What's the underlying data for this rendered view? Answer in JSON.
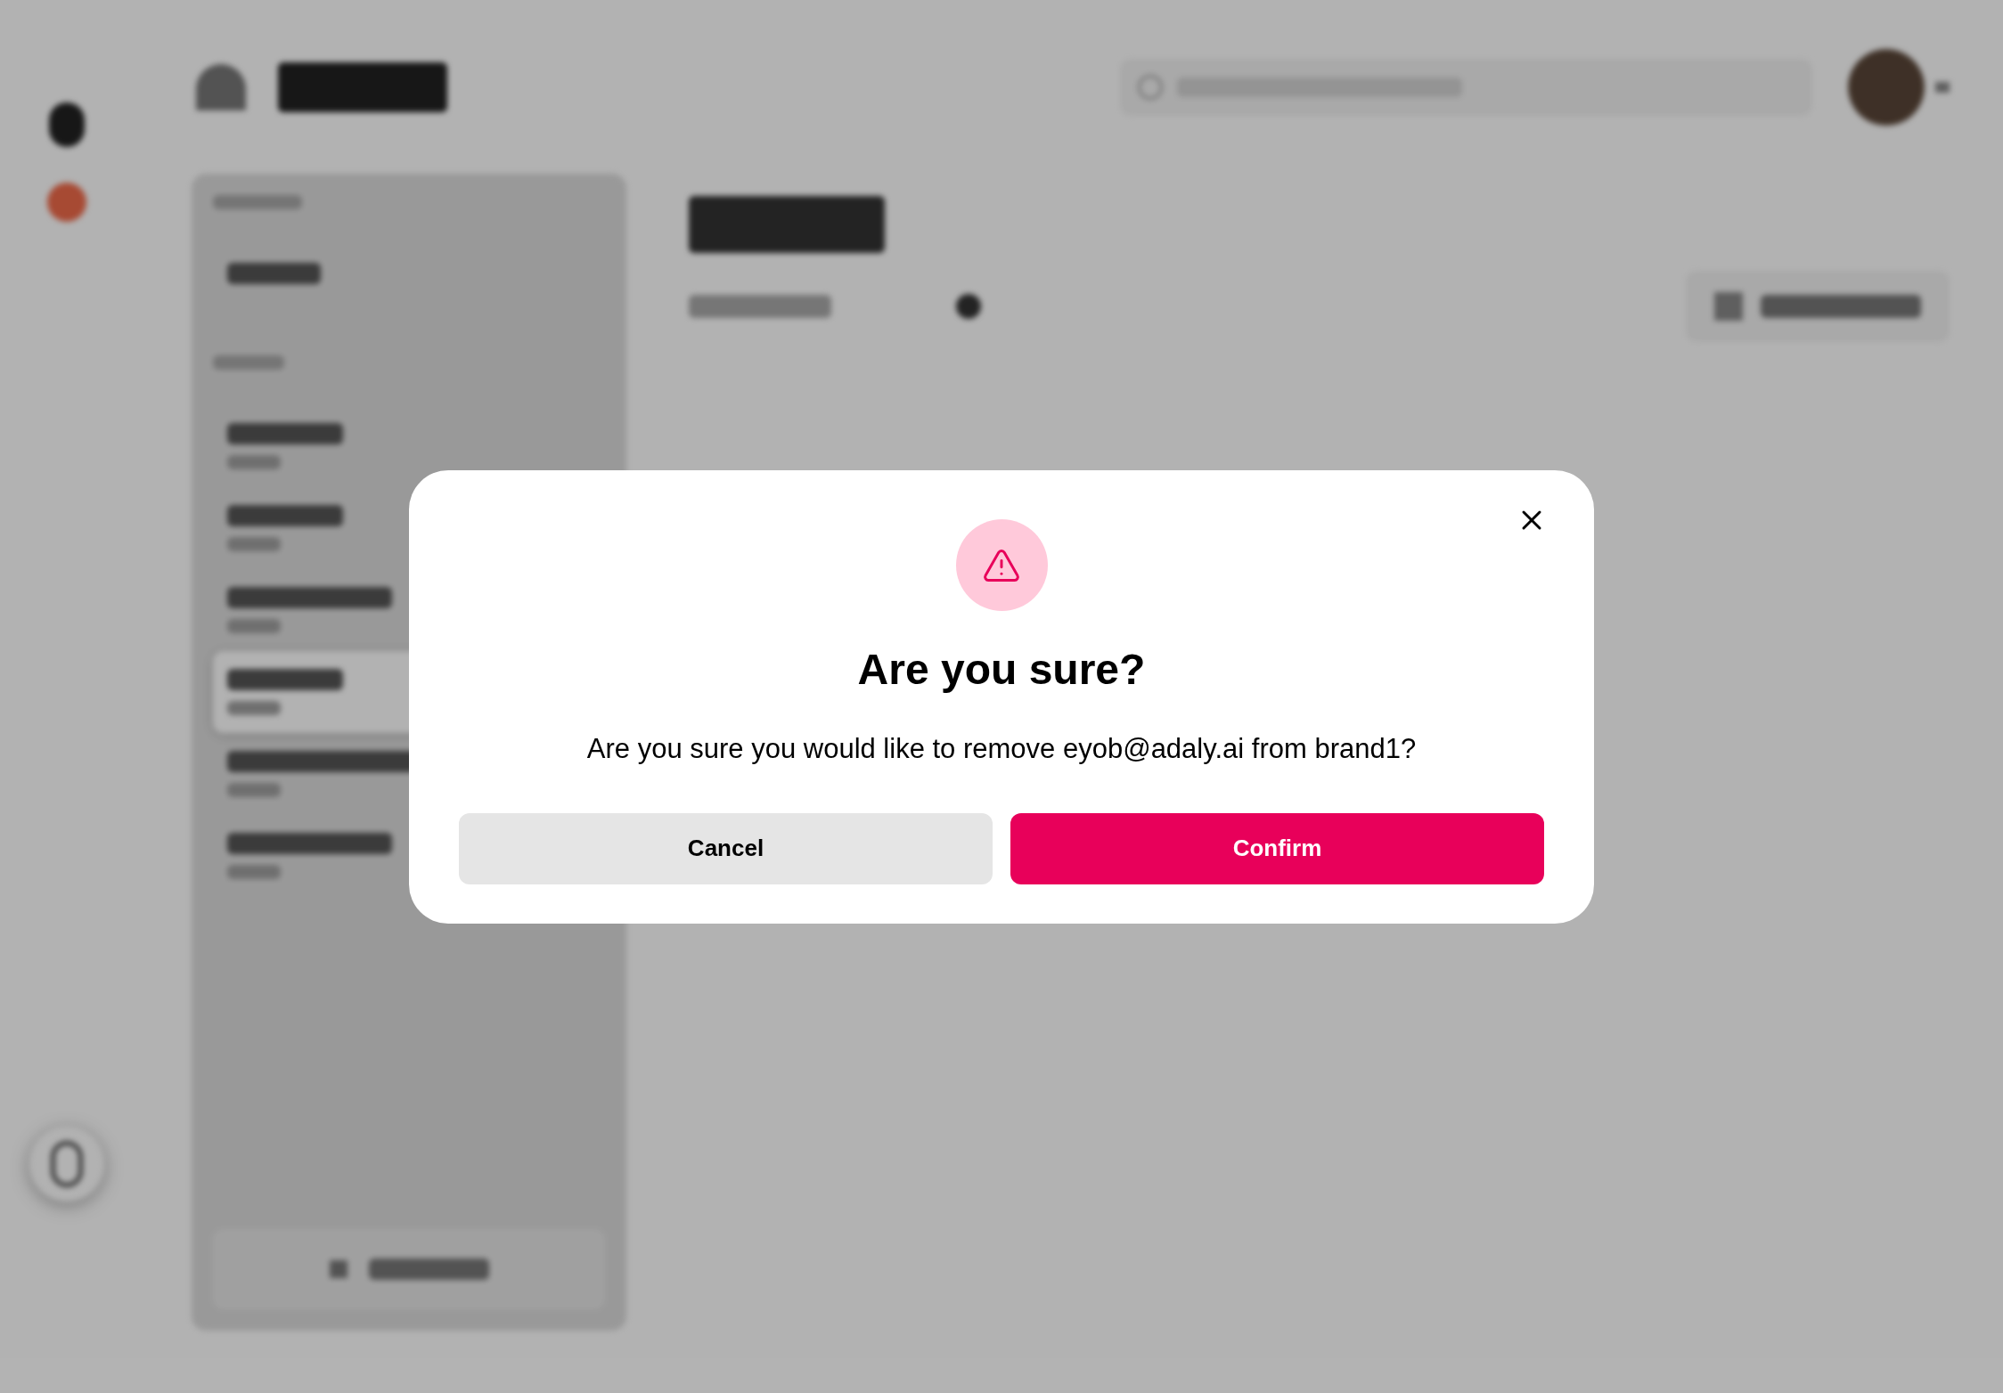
{
  "sidebar": {
    "items": [
      {
        "selected": false
      },
      {
        "selected": false
      },
      {
        "selected": false
      },
      {
        "selected": true
      },
      {
        "selected": false
      },
      {
        "selected": false
      }
    ]
  },
  "dialog": {
    "title": "Are you sure?",
    "message": "Are you sure you would like to remove eyob@adaly.ai from brand1?",
    "buttons": [
      {
        "label": "Cancel",
        "kind": "secondary"
      },
      {
        "label": "Confirm",
        "kind": "primary"
      }
    ]
  }
}
